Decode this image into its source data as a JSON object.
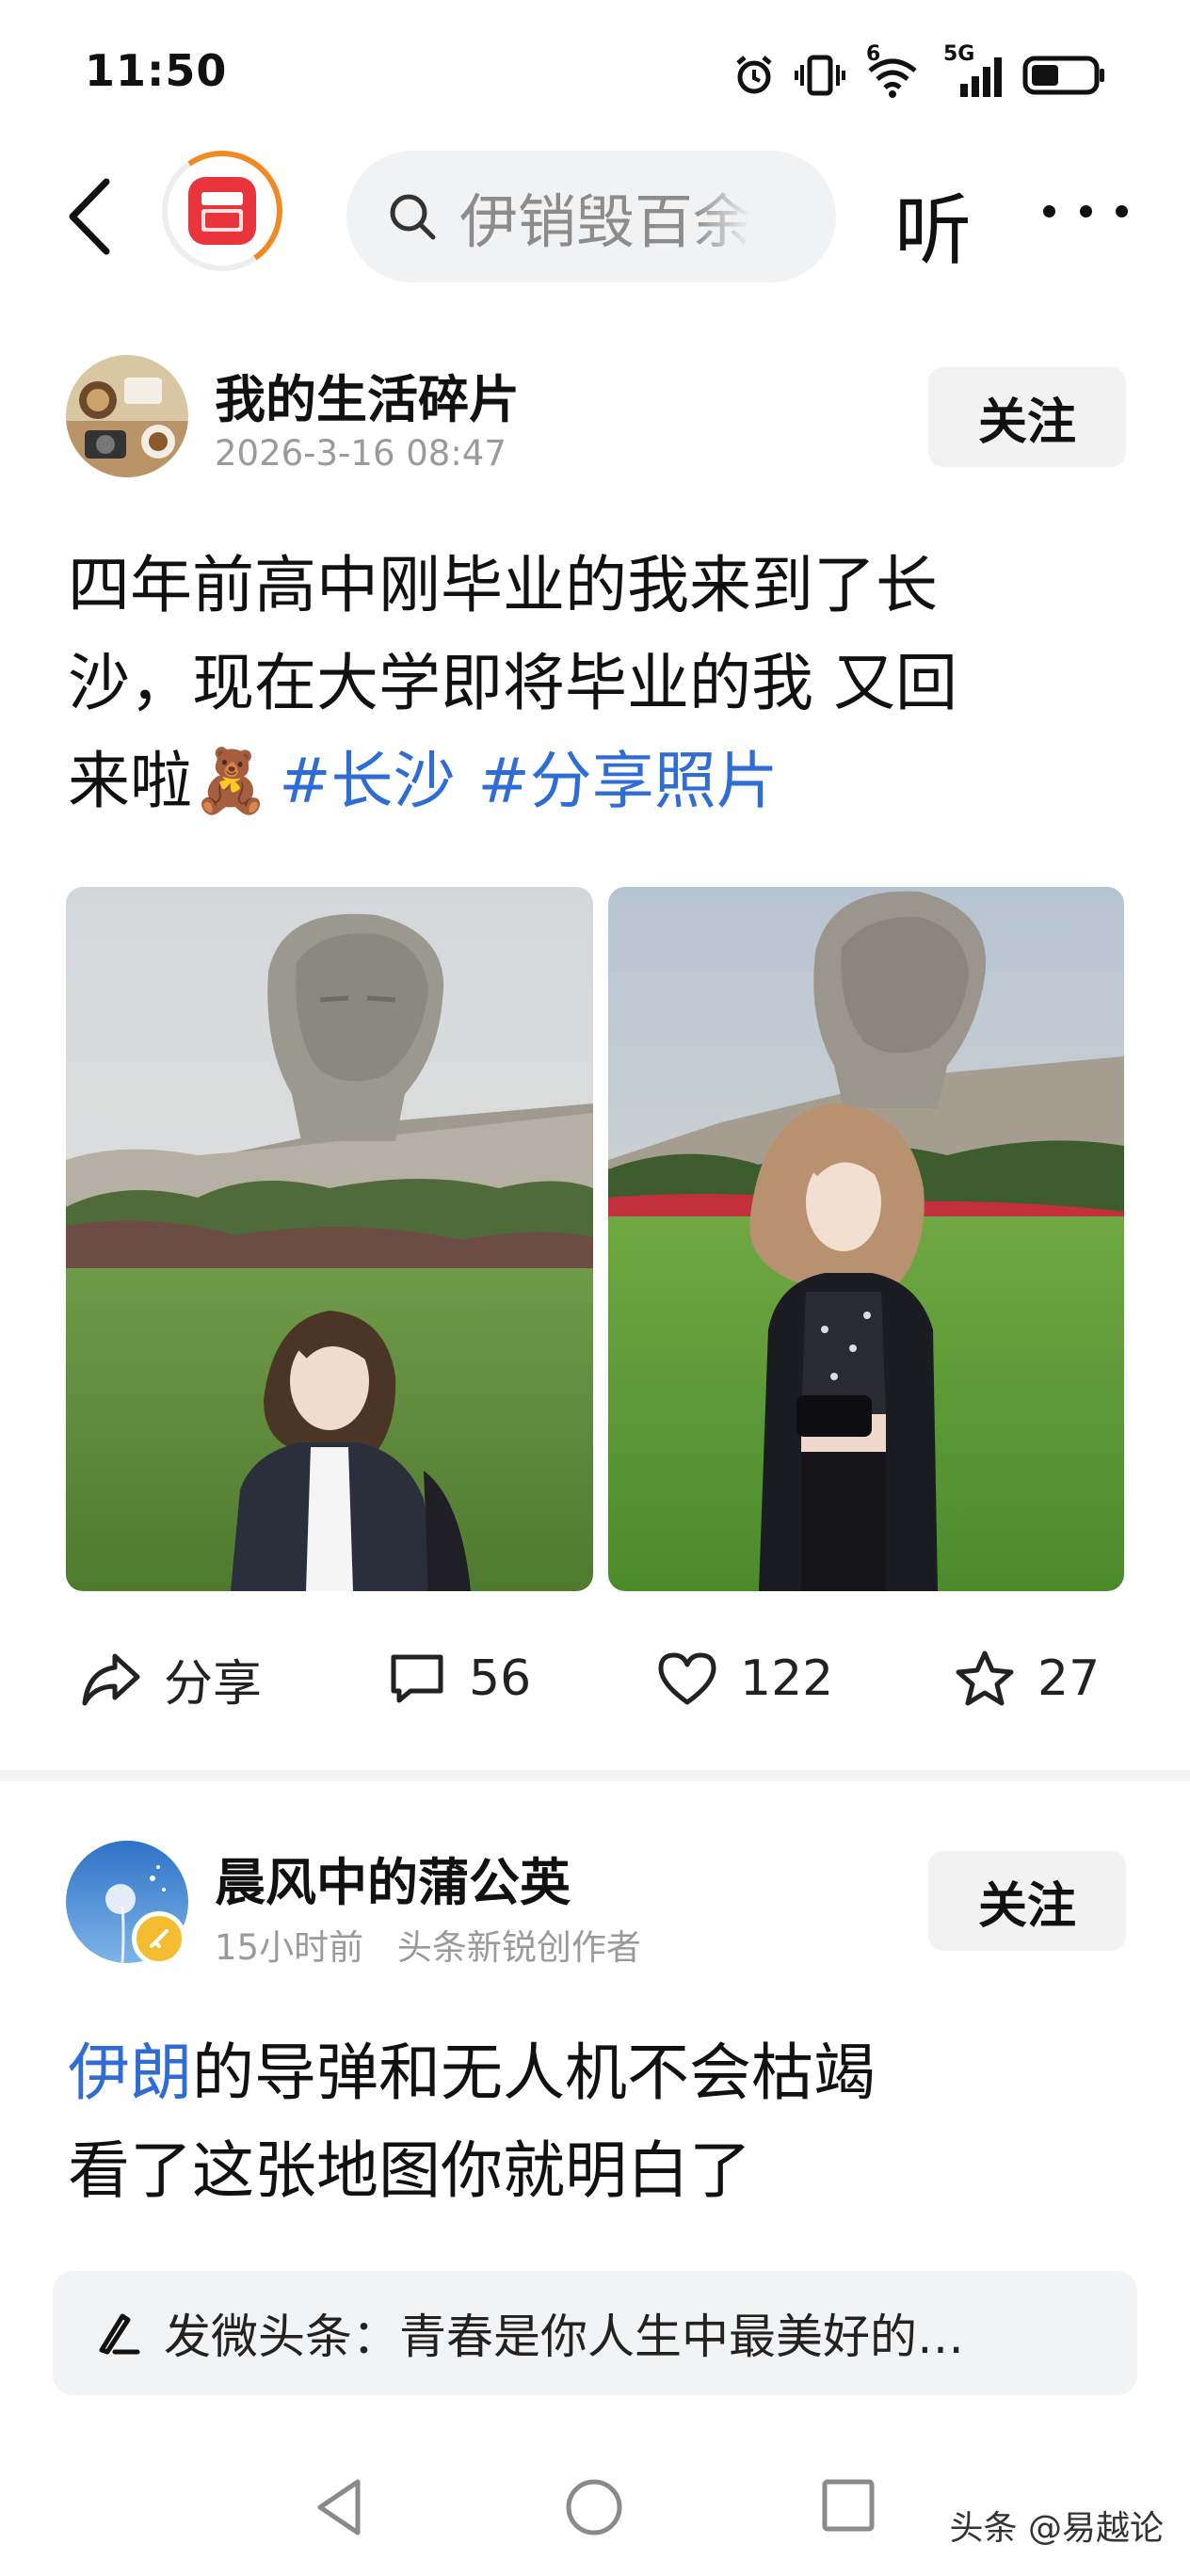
{
  "status_bar": {
    "time": "11:50",
    "signal_labels": [
      "6",
      "5G"
    ],
    "battery_level": 0.45
  },
  "top_nav": {
    "search_placeholder": "伊销毁百余",
    "listen_label": "听"
  },
  "posts": [
    {
      "author": "我的生活碎片",
      "time": "2026-3-16 08:47",
      "follow_label": "关注",
      "text_lines": [
        "四年前高中刚毕业的我来到了长",
        "沙，现在大学即将毕业的我 又回",
        "来啦🧸"
      ],
      "hashtags": [
        "#长沙",
        "#分享照片"
      ],
      "actions": {
        "share": "分享",
        "comments": "56",
        "likes": "122",
        "favorites": "27"
      }
    },
    {
      "author": "晨风中的蒲公英",
      "time": "15小时前",
      "author_tag": "头条新锐创作者",
      "follow_label": "关注",
      "highlight": "伊朗",
      "line1_rest": "的导弹和无人机不会枯竭",
      "line2": "看了这张地图你就明白了"
    }
  ],
  "compose_bar": {
    "text": "发微头条：青春是你人生中最美好的…"
  },
  "watermark": "头条 @易越论",
  "colors": {
    "hashtag": "#2f6cd6",
    "accent": "#f08a24",
    "logo": "#e8343a",
    "meta": "#9a9a9a"
  }
}
